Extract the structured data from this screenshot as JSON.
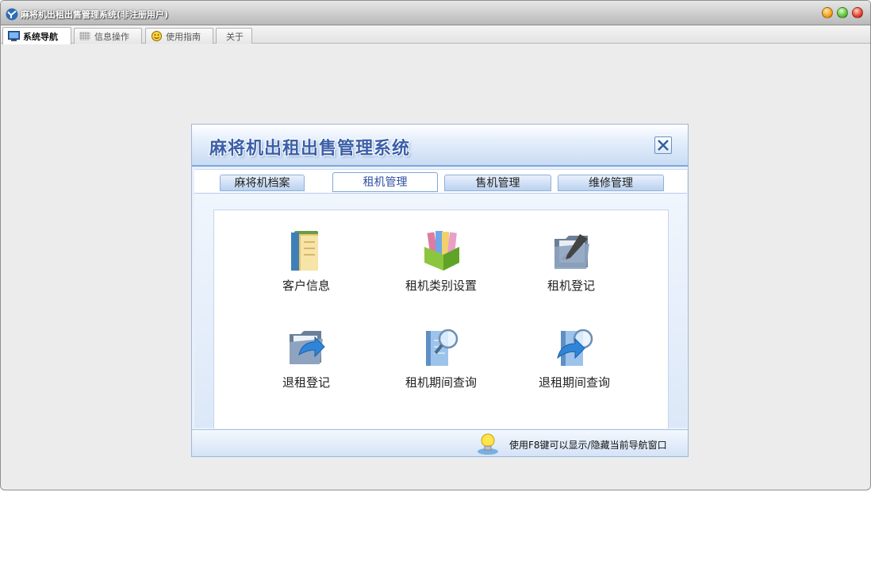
{
  "window": {
    "title": "麻将机出租出售管理系统(非注册用户)"
  },
  "main_tabs": [
    {
      "label": "系统导航",
      "icon": "monitor-icon",
      "active": true
    },
    {
      "label": "信息操作",
      "icon": "grid-icon",
      "active": false
    },
    {
      "label": "使用指南",
      "icon": "smiley-icon",
      "active": false
    },
    {
      "label": "关于",
      "icon": "",
      "active": false
    }
  ],
  "panel": {
    "title": "麻将机出租出售管理系统",
    "sub_tabs": [
      {
        "label": "麻将机档案",
        "active": false
      },
      {
        "label": "租机管理",
        "active": true
      },
      {
        "label": "售机管理",
        "active": false
      },
      {
        "label": "维修管理",
        "active": false
      }
    ],
    "functions": [
      {
        "label": "客户信息",
        "icon": "folder-documents-icon"
      },
      {
        "label": "租机类别设置",
        "icon": "book-stack-icon"
      },
      {
        "label": "租机登记",
        "icon": "folder-pen-icon"
      },
      {
        "label": "退租登记",
        "icon": "folder-return-icon"
      },
      {
        "label": "租机期间查询",
        "icon": "search-documents-icon"
      },
      {
        "label": "退租期间查询",
        "icon": "search-return-icon"
      }
    ],
    "status_hint": "使用F8键可以显示/隐藏当前导航窗口"
  },
  "colors": {
    "accent": "#3b5fa8",
    "panel_border": "#9ab8dd",
    "close_x": "#2f5fa0"
  }
}
